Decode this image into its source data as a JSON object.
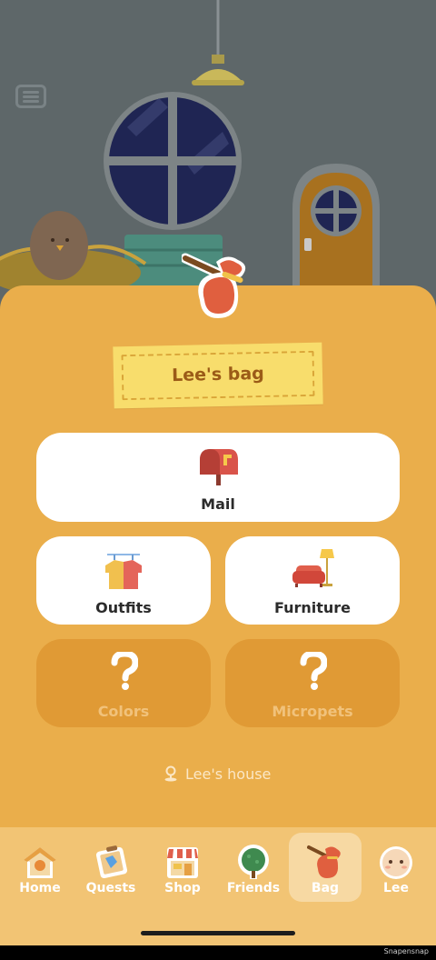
{
  "scene": {
    "menu_icon": "hamburger-menu-icon"
  },
  "bag_title": "Lee's bag",
  "menu": {
    "mail": {
      "label": "Mail",
      "icon": "mailbox-icon"
    },
    "outfits": {
      "label": "Outfits",
      "icon": "clothes-rack-icon"
    },
    "furniture": {
      "label": "Furniture",
      "icon": "sofa-lamp-icon"
    },
    "colors": {
      "label": "Colors",
      "icon": "question-mark-icon",
      "locked": true
    },
    "micropets": {
      "label": "Micropets",
      "icon": "question-mark-icon",
      "locked": true
    }
  },
  "house_link": {
    "label": "Lee's house",
    "icon": "map-pin-icon"
  },
  "tabs": [
    {
      "label": "Home",
      "icon": "birdhouse-icon"
    },
    {
      "label": "Quests",
      "icon": "quest-map-icon"
    },
    {
      "label": "Shop",
      "icon": "storefront-icon"
    },
    {
      "label": "Friends",
      "icon": "tree-icon"
    },
    {
      "label": "Bag",
      "icon": "bag-icon",
      "active": true
    },
    {
      "label": "Lee",
      "icon": "bird-face-icon"
    }
  ],
  "footer_text": "Snapensnap",
  "colors": {
    "sheet": "#eaae4b",
    "tag": "#f8dd6c",
    "locked_card": "#e09a35",
    "tabbar": "#f2c474",
    "wall": "#5e6769"
  }
}
